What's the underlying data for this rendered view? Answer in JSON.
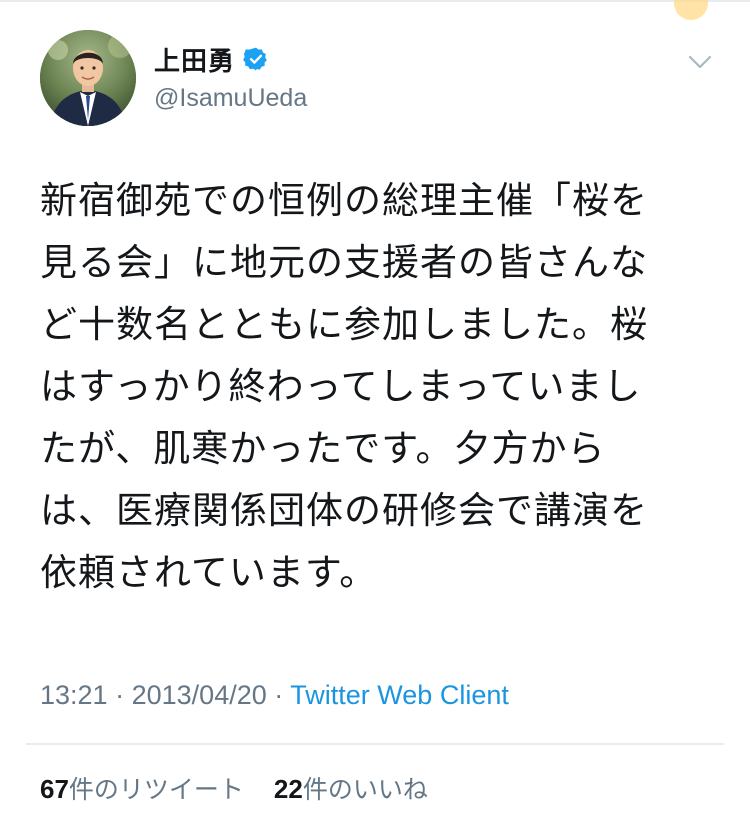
{
  "tweet": {
    "author": {
      "display_name": "上田勇",
      "handle": "@IsamuUeda",
      "verified": true
    },
    "text_lines": [
      "新宿御苑での恒例の総理主催「桜を",
      "見る会」に地元の支援者の皆さんな",
      "ど十数名とともに参加しました。桜",
      "はすっかり終わってしまっていまし",
      "たが、肌寒かったです。夕方から",
      "は、医療関係団体の研修会で講演を",
      "依頼されています。"
    ],
    "time": "13:21",
    "date": "2013/04/20",
    "separator": "·",
    "source": "Twitter Web Client",
    "retweets": {
      "count": "67",
      "label": "件のリツイート"
    },
    "likes": {
      "count": "22",
      "label": "件のいいね"
    }
  },
  "icons": {
    "verified": "verified-badge-icon",
    "menu": "chevron-down-icon",
    "avatar": "profile-photo"
  },
  "colors": {
    "text_primary": "#14171a",
    "text_secondary": "#657786",
    "link": "#1b95e0",
    "verified": "#1da1f2",
    "divider": "#e6ecf0"
  }
}
